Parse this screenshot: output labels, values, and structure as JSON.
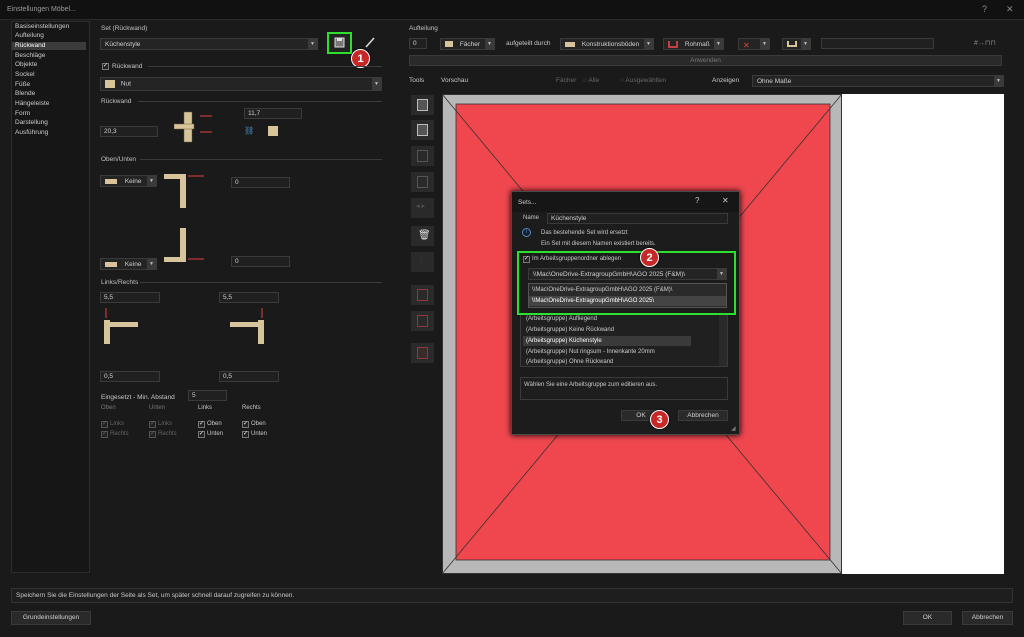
{
  "window": {
    "title": "Einstellungen Möbel...",
    "help": "?",
    "close": "✕"
  },
  "nav": {
    "items": [
      "Basiseinstellungen",
      "Aufteilung",
      "Rückwand",
      "Beschläge",
      "Objekte",
      "Sockel",
      "Füße",
      "Blende",
      "Hängeleiste",
      "Form",
      "Darstellung",
      "Ausführung"
    ],
    "selected_index": 2
  },
  "set": {
    "header": "Set (Rückwand)",
    "value": "Küchenstyle"
  },
  "rueckwand_check": {
    "label": "Rückwand"
  },
  "joint": {
    "value": "Nut"
  },
  "rueckwand": {
    "header": "Rückwand",
    "value_left": "20,3",
    "value_right": "11,7"
  },
  "oben_unten": {
    "header": "Oben/Unten",
    "combo1": "Keine",
    "value1": "0",
    "combo2": "Keine",
    "value2": "0"
  },
  "links_rechts": {
    "header": "Links/Rechts",
    "l1": "5,5",
    "r1": "5,5",
    "l2": "0,5",
    "r2": "0,5"
  },
  "eingesetzt": {
    "label": "Eingesetzt - Min. Abstand",
    "value": "5",
    "cols": [
      "Oben",
      "Unten",
      "Links",
      "Rechts"
    ],
    "links_items": [
      "Oben",
      "Unten"
    ],
    "rechts_items": [
      "Oben",
      "Unten"
    ],
    "oben_items": [
      "Links",
      "Rechts"
    ],
    "unten_items": [
      "Links",
      "Rechts"
    ]
  },
  "aufteilung": {
    "header": "Aufteilung",
    "count": "0",
    "faecher": "Fächer",
    "aufgeteilt_label": "aufgeteilt durch",
    "konstruktionsboeden": "Konstruktionsböden",
    "rohmass": "Rohmaß",
    "apply": "Anwenden"
  },
  "tools": {
    "label": "Tools"
  },
  "vorschau": {
    "label": "Vorschau",
    "faecher_label": "Fächer",
    "alle": "Alle",
    "ausgewaehlte": "Ausgewählten",
    "anzeigen_label": "Anzeigen",
    "anzeigen_value": "Ohne Maße"
  },
  "dialog": {
    "title": "Sets...",
    "help": "?",
    "close": "✕",
    "name_label": "Name",
    "name_value": "Küchenstyle",
    "info1": "Das bestehende Set wird ersetzt",
    "info2": "Ein Set mit diesem Namen existiert bereits.",
    "checkbox_label": "Im Arbeitsgruppenordner ablegen",
    "folder_selected": "\\\\Mac\\OneDrive-ExtragroupGmbH\\AGO 2025 (F&M)\\",
    "folder_options": [
      "\\\\Mac\\OneDrive-ExtragroupGmbH\\AGO 2025 (F&M)\\",
      "\\\\Mac\\OneDrive-ExtragroupGmbH\\AGO 2025\\"
    ],
    "list": [
      "(Arbeitsgruppe) Aufliegend",
      "(Arbeitsgruppe) Keine Rückwand",
      "(Arbeitsgruppe) Küchenstyle",
      "(Arbeitsgruppe) Nut ringsum - Innenkante 20mm",
      "(Arbeitsgruppe) Ohne Rückwand"
    ],
    "list_selected_index": 2,
    "description": "Wählen Sie eine Arbeitsgruppe zum editieren aus.",
    "ok": "OK",
    "cancel": "Abbrechen"
  },
  "status": {
    "text": "Speichern Sie die Einstellungen der Seite als Set, um später schnell darauf zugreifen zu können."
  },
  "footer": {
    "grund": "Grundeinstellungen",
    "ok": "OK",
    "cancel": "Abbrechen"
  },
  "badges": [
    "1",
    "2",
    "3"
  ],
  "colors": {
    "highlight": "#2ee02e",
    "badge": "#c62828",
    "preview_red": "#f0474f",
    "background": "#1a1a1a"
  }
}
